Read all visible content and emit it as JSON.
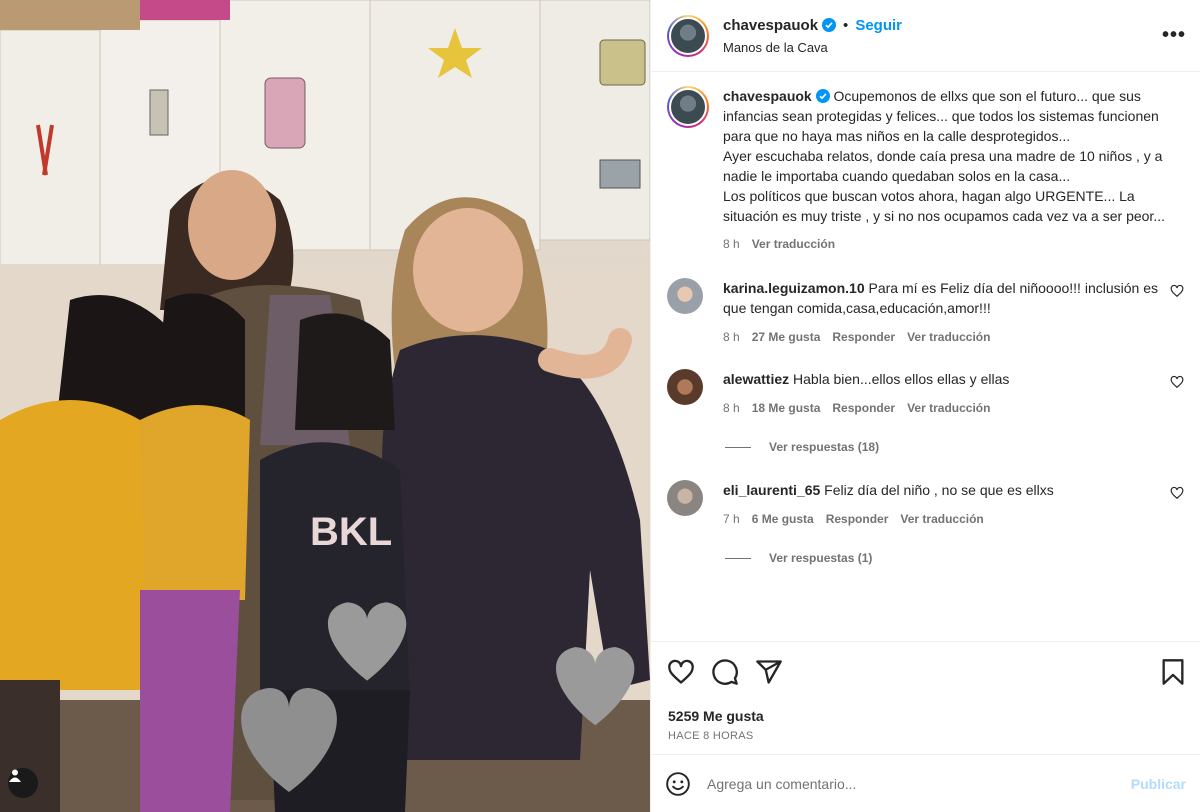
{
  "post": {
    "username": "chavespauok",
    "follow_label": "Seguir",
    "dot": "•",
    "location": "Manos de la Cava",
    "more_label": "•••"
  },
  "caption": {
    "username": "chavespauok",
    "text_lines": [
      "Ocupemonos de ellxs que son el futuro... que sus infancias sean protegidas y felices... que todos los sistemas funcionen para que no haya mas niños en la calle desprotegidos...",
      "Ayer escuchaba relatos, donde caía presa una madre de 10 niños , y a nadie le importaba cuando quedaban solos en la casa...",
      "Los políticos que buscan votos ahora, hagan algo URGENTE... La situación es muy triste , y si no nos ocupamos cada vez va a ser peor..."
    ],
    "time": "8 h",
    "translate": "Ver traducción"
  },
  "comments": [
    {
      "username": "karina.leguizamon.10",
      "text": "Para mí es Feliz día del niñoooo!!! inclusión es que tengan comida,casa,educación,amor!!!",
      "time": "8 h",
      "likes": "27 Me gusta",
      "reply": "Responder",
      "translate": "Ver traducción",
      "replies": ""
    },
    {
      "username": "alewattiez",
      "text": "Habla bien...ellos ellos ellas y ellas",
      "time": "8 h",
      "likes": "18 Me gusta",
      "reply": "Responder",
      "translate": "Ver traducción",
      "replies": "Ver respuestas (18)"
    },
    {
      "username": "eli_laurenti_65",
      "text": "Feliz día del niño , no se que es ellxs",
      "time": "7 h",
      "likes": "6 Me gusta",
      "reply": "Responder",
      "translate": "Ver traducción",
      "replies": "Ver respuestas (1)"
    }
  ],
  "stats": {
    "likes": "5259 Me gusta",
    "ago": "HACE 8 HORAS"
  },
  "add_comment": {
    "placeholder": "Agrega un comentario...",
    "publish": "Publicar"
  },
  "colors": {
    "accent": "#0095f6",
    "publish_disabled": "#b3dbff",
    "muted": "#737373"
  }
}
